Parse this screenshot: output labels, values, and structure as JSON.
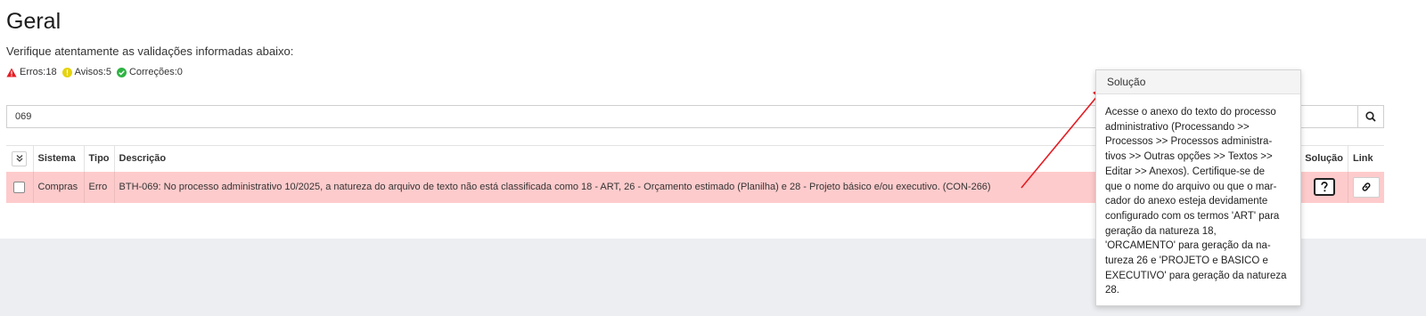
{
  "header": {
    "title": "Geral",
    "subtitle": "Verifique atentamente as validações informadas abaixo:"
  },
  "counters": {
    "errors": "Erros:18",
    "warnings": "Avisos:5",
    "corrections": "Correções:0"
  },
  "search": {
    "value": "069"
  },
  "table": {
    "columns": {
      "sistema": "Sistema",
      "tipo": "Tipo",
      "descricao": "Descrição",
      "solucao": "Solução",
      "link": "Link"
    },
    "rows": [
      {
        "sistema": "Compras",
        "tipo": "Erro",
        "descricao": "BTH-069: No processo administrativo 10/2025, a natureza do arquivo de texto não está classificada como 18 - ART, 26 - Orçamento estimado (Planilha) e 28 - Projeto básico e/ou executivo. (CON-266)"
      }
    ]
  },
  "popover": {
    "title": "Solução",
    "lines": [
      "Acesse o anexo do texto do processo",
      "administrativo (Processando >>",
      "Processos >> Processos administra-",
      "tivos >> Outras opções >> Textos >>",
      "Editar >> Anexos). Certifique-se de",
      "que o nome do arquivo ou que o mar-",
      "cador do anexo esteja devidamente",
      "configurado com os termos 'ART' para",
      "geração da natureza 18,",
      "'ORCAMENTO' para geração da na-",
      "tureza 26 e 'PROJETO e BASICO e",
      "EXECUTIVO' para geração da natureza",
      "28."
    ]
  },
  "icons": {
    "error": "warning-triangle-icon",
    "warning": "exclamation-circle-icon",
    "correction": "check-circle-icon",
    "search": "search-icon",
    "select_all": "double-chevron-down-icon",
    "solution": "question-icon",
    "link": "link-icon"
  },
  "colors": {
    "error": "#e51c23",
    "warning": "#e5d30f",
    "correction": "#2fb344",
    "row_error_bg": "#fecbcc",
    "arrow": "#e51c23"
  }
}
